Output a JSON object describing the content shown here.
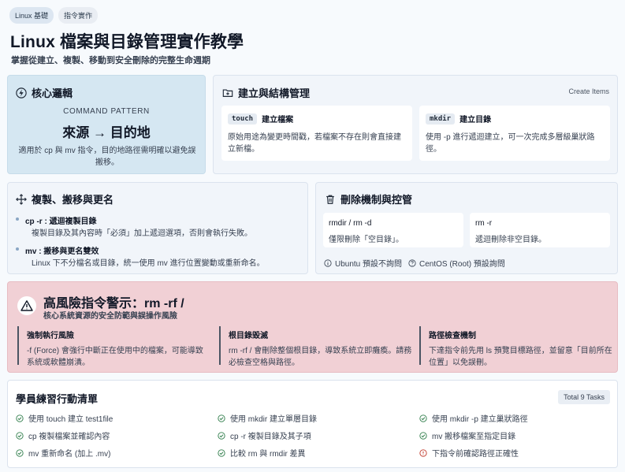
{
  "tags": [
    "Linux 基礎",
    "指令實作"
  ],
  "page": {
    "title": "Linux 檔案與目錄管理實作教學",
    "subtitle": "掌握從建立、複製、移動到安全刪除的完整生命週期"
  },
  "core": {
    "title": "核心邏輯",
    "pattern_label": "COMMAND PATTERN",
    "formula": "來源 → 目的地",
    "note": "適用於 cp 與 mv 指令，目的地路徑需明確以避免誤搬移。"
  },
  "create": {
    "title": "建立與結構管理",
    "tag": "Create Items",
    "items": [
      {
        "cmd": "touch",
        "label": "建立檔案",
        "desc": "原始用途為變更時間戳，若檔案不存在則會直接建立新檔。"
      },
      {
        "cmd": "mkdir",
        "label": "建立目錄",
        "desc": "使用 -p 進行遞迴建立，可一次完成多層級巢狀路徑。"
      }
    ]
  },
  "copymove": {
    "title": "複製、搬移與更名",
    "items": [
      {
        "head": "cp -r : 遞迴複製目錄",
        "desc": "複製目錄及其內容時「必須」加上遞迴選項，否則會執行失敗。"
      },
      {
        "head": "mv : 搬移與更名雙效",
        "desc": "Linux 下不分檔名或目錄，統一使用 mv 進行位置變動或重新命名。"
      }
    ]
  },
  "delete": {
    "title": "刪除機制與控管",
    "boxes": [
      {
        "cmd": "rmdir / rm -d",
        "desc": "僅限刪除「空目錄」。"
      },
      {
        "cmd": "rm -r",
        "desc": "遞迴刪除非空目錄。"
      }
    ],
    "notes": [
      "Ubuntu 預設不詢問",
      "CentOS (Root) 預設詢問"
    ]
  },
  "warning": {
    "title": "高風險指令警示：rm -rf /",
    "subtitle": "核心系統資源的安全防範與誤操作風險",
    "risks": [
      {
        "head": "強制執行風險",
        "desc": "-f (Force) 會強行中斷正在使用中的檔案，可能導致系統或軟體崩潰。"
      },
      {
        "head": "根目錄毀滅",
        "desc": "rm -rf / 會刪除整個根目錄，導致系統立即癱瘓。請務必檢查空格與路徑。"
      },
      {
        "head": "路徑檢查機制",
        "desc": "下達指令前先用 ls 預覽目標路徑，並留意「目前所在位置」以免誤刪。"
      }
    ]
  },
  "tasks": {
    "title": "學員練習行動清單",
    "count": "Total 9 Tasks",
    "items": [
      {
        "text": "使用 touch 建立 test1file",
        "status": "done"
      },
      {
        "text": "使用 mkdir 建立單層目錄",
        "status": "done"
      },
      {
        "text": "使用 mkdir -p 建立巢狀路徑",
        "status": "done"
      },
      {
        "text": "cp 複製檔案並確認內容",
        "status": "done"
      },
      {
        "text": "cp -r 複製目錄及其子項",
        "status": "done"
      },
      {
        "text": "mv 搬移檔案至指定目錄",
        "status": "done"
      },
      {
        "text": "mv 重新命名 (加上 .mv)",
        "status": "done"
      },
      {
        "text": "比較 rm 與 rmdir 差異",
        "status": "done"
      },
      {
        "text": "下指令前確認路徑正確性",
        "status": "warning"
      }
    ]
  },
  "colors": {
    "done": "#2f7d4a",
    "warning": "#c0392b",
    "danger_bg": "#f1d0d5",
    "core_bg": "#d5e7f2"
  }
}
